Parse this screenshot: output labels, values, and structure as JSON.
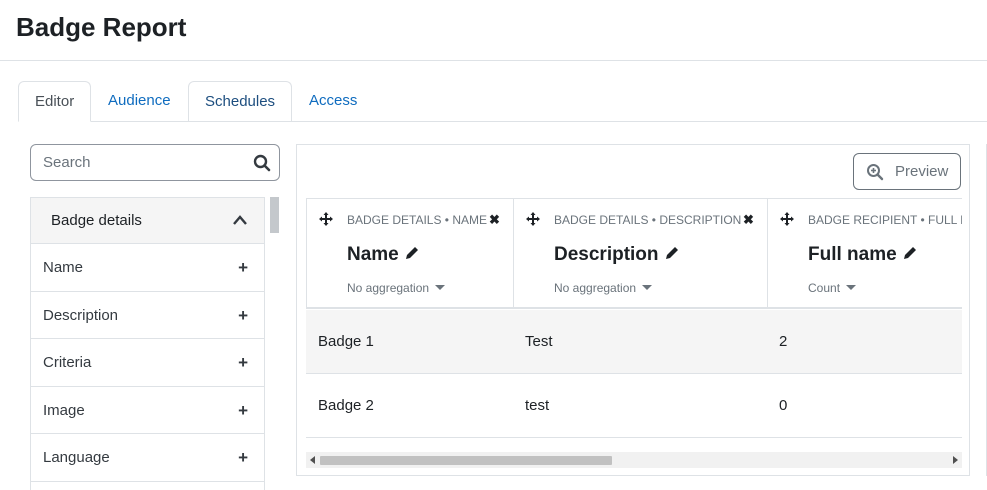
{
  "page": {
    "title": "Badge Report"
  },
  "tabs": [
    {
      "label": "Editor",
      "active": true
    },
    {
      "label": "Audience",
      "active": false
    },
    {
      "label": "Schedules",
      "active": false
    },
    {
      "label": "Access",
      "active": false
    }
  ],
  "search": {
    "placeholder": "Search",
    "icon": "search-icon"
  },
  "sidebar": {
    "section_label": "Badge details",
    "section_icon": "chevron-up-icon",
    "items": [
      {
        "label": "Name",
        "icon": "plus-icon"
      },
      {
        "label": "Description",
        "icon": "plus-icon"
      },
      {
        "label": "Criteria",
        "icon": "plus-icon"
      },
      {
        "label": "Image",
        "icon": "plus-icon"
      },
      {
        "label": "Language",
        "icon": "plus-icon"
      }
    ]
  },
  "preview": {
    "label": "Preview",
    "icon": "zoom-in-icon"
  },
  "table": {
    "columns": [
      {
        "source": "BADGE DETAILS • NAME",
        "title": "Name",
        "aggregation": "No aggregation"
      },
      {
        "source": "BADGE DETAILS • DESCRIPTION",
        "title": "Description",
        "aggregation": "No aggregation"
      },
      {
        "source": "BADGE RECIPIENT • FULL N",
        "title": "Full name",
        "aggregation": "Count"
      }
    ],
    "rows": [
      [
        "Badge 1",
        "Test",
        "2"
      ],
      [
        "Badge 2",
        "test",
        "0"
      ]
    ]
  },
  "colors": {
    "link": "#0f6cbf",
    "border": "#dee2e6",
    "text": "#1d2125",
    "muted": "#6a737b"
  }
}
